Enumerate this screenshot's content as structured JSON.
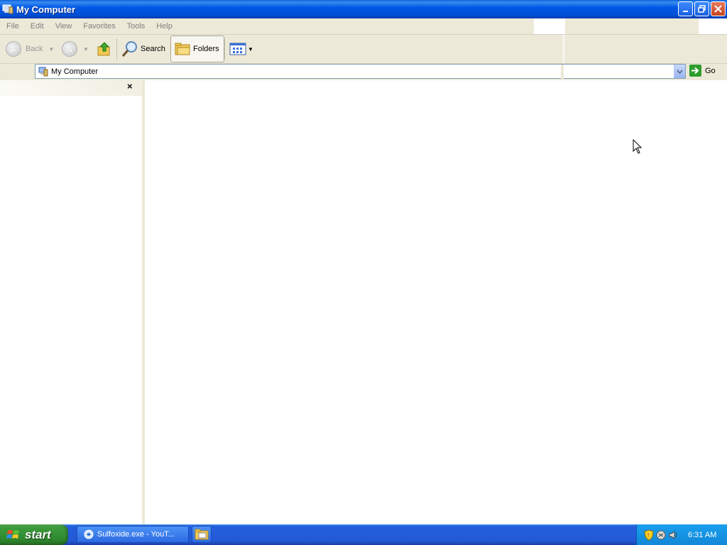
{
  "window": {
    "title": "My Computer"
  },
  "menu": {
    "items": [
      "File",
      "Edit",
      "View",
      "Favorites",
      "Tools",
      "Help"
    ]
  },
  "toolbar": {
    "back_label": "Back",
    "search_label": "Search",
    "folders_label": "Folders"
  },
  "address": {
    "value": "My Computer",
    "go_label": "Go"
  },
  "folder_pane": {
    "close_glyph": "×"
  },
  "taskbar": {
    "start_label": "start",
    "tasks": [
      "Sulfoxide.exe - YouT..."
    ],
    "clock": "6:31 AM"
  },
  "colors": {
    "titlebar": "#0058e6",
    "start_button": "#3c9a3c",
    "taskbar": "#245edb",
    "tray": "#1287d8"
  }
}
